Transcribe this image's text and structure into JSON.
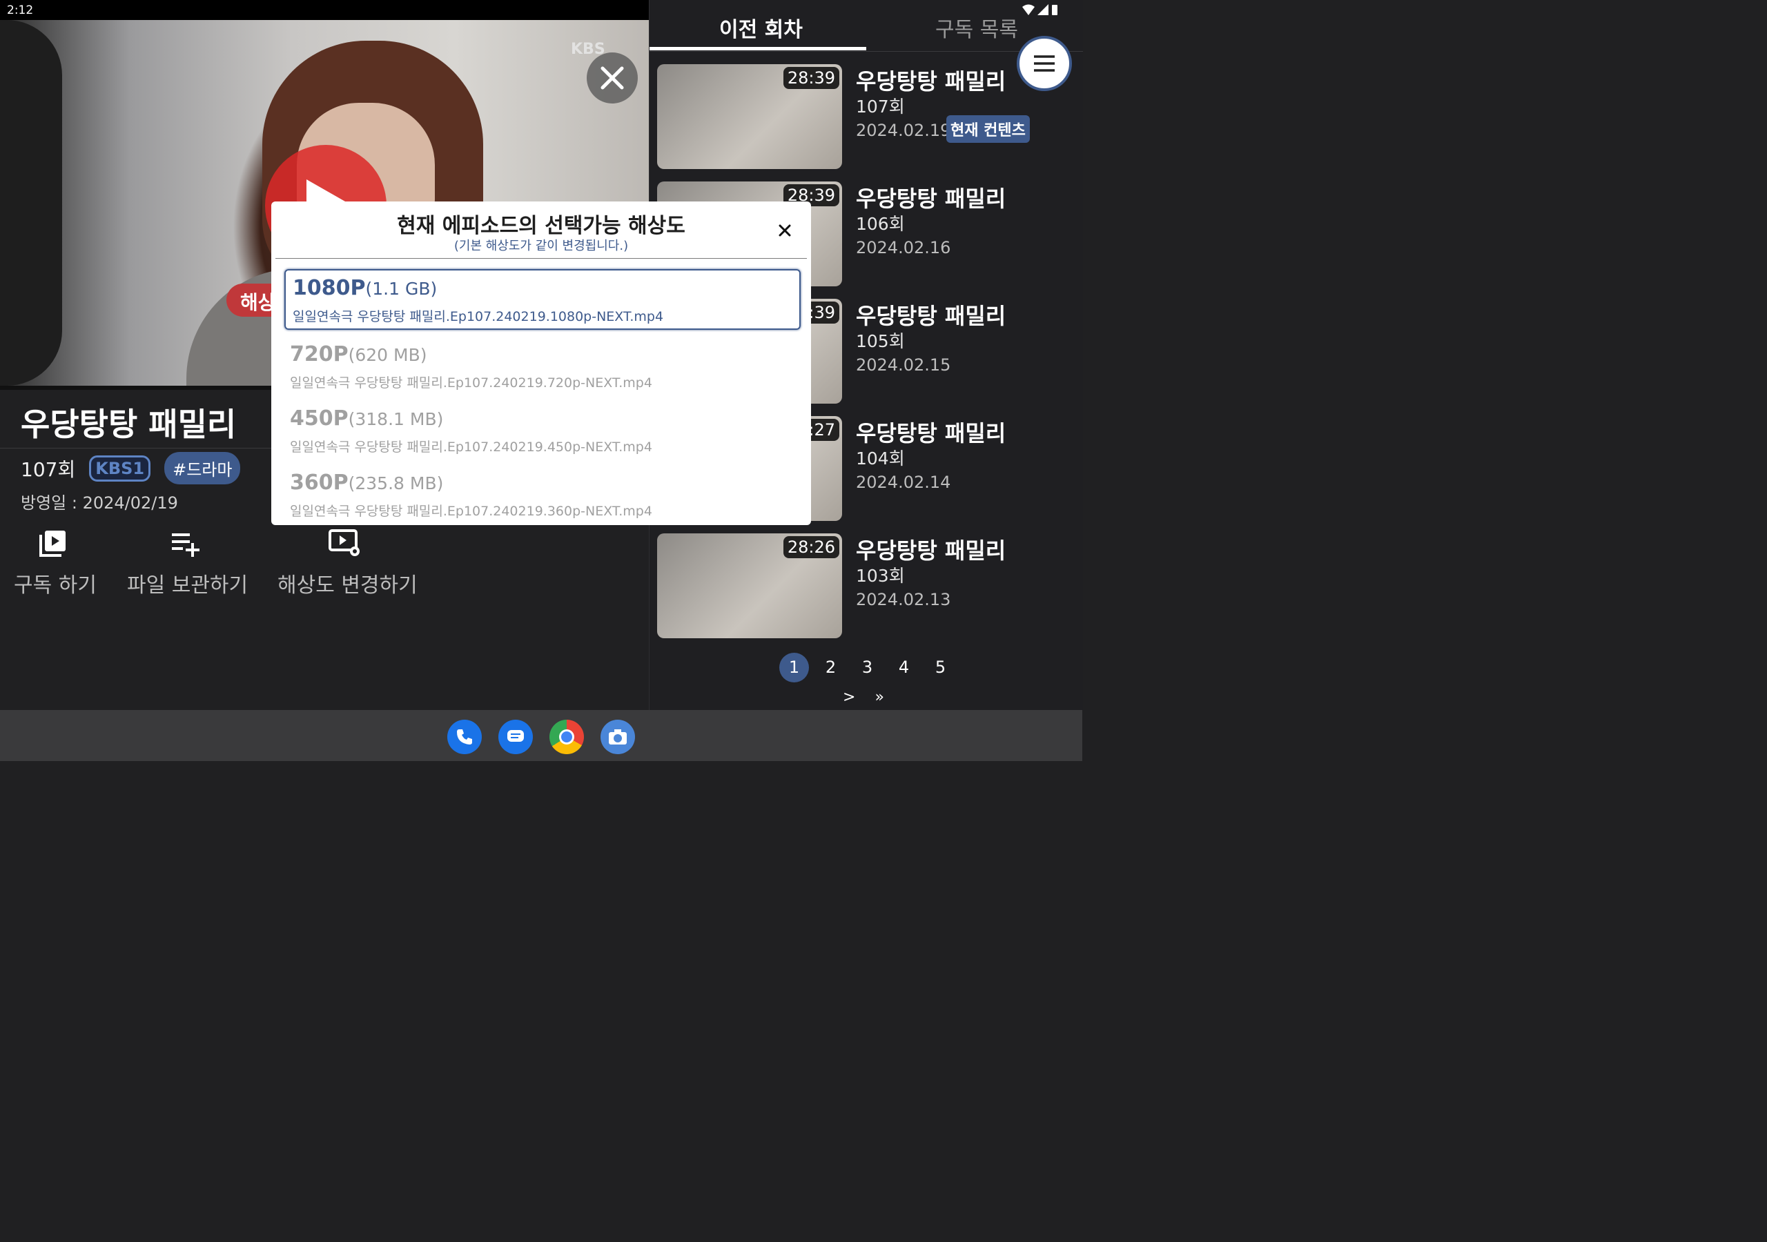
{
  "status": {
    "time": "2:12"
  },
  "video": {
    "watermark": "KBS",
    "resolution_pill": "해상"
  },
  "show": {
    "title": "우당탕탕 패밀리",
    "episode": "107회",
    "channel": "KBS1",
    "genre": "#드라마",
    "airdate": "방영일 : 2024/02/19"
  },
  "actions": [
    {
      "label": "구독 하기",
      "icon": "subscribe-icon"
    },
    {
      "label": "파일 보관하기",
      "icon": "playlist-add-icon"
    },
    {
      "label": "해상도 변경하기",
      "icon": "video-settings-icon"
    }
  ],
  "tabs": {
    "previous": "이전 회차",
    "subscriptions": "구독 목록"
  },
  "episodes": [
    {
      "title": "우당탕탕 패밀리",
      "num": "107회",
      "date": "2024.02.19",
      "duration": "28:39",
      "badge": "현재 컨텐츠"
    },
    {
      "title": "우당탕탕 패밀리",
      "num": "106회",
      "date": "2024.02.16",
      "duration": "28:39"
    },
    {
      "title": "우당탕탕 패밀리",
      "num": "105회",
      "date": "2024.02.15",
      "duration": ":39"
    },
    {
      "title": "우당탕탕 패밀리",
      "num": "104회",
      "date": "2024.02.14",
      "duration": ":27"
    },
    {
      "title": "우당탕탕 패밀리",
      "num": "103회",
      "date": "2024.02.13",
      "duration": "28:26"
    }
  ],
  "pagination": {
    "pages": [
      "1",
      "2",
      "3",
      "4",
      "5"
    ],
    "current": "1",
    "next": ">",
    "last": "»"
  },
  "modal": {
    "title": "현재 에피소드의 선택가능 해상도",
    "subtitle": "(기본 해상도가 같이 변경됩니다.)",
    "options": [
      {
        "res": "1080P",
        "size": "(1.1 GB)",
        "file": "일일연속극 우당탕탕 패밀리.Ep107.240219.1080p-NEXT.mp4",
        "selected": true
      },
      {
        "res": "720P",
        "size": "(620 MB)",
        "file": "일일연속극 우당탕탕 패밀리.Ep107.240219.720p-NEXT.mp4"
      },
      {
        "res": "450P",
        "size": "(318.1 MB)",
        "file": "일일연속극 우당탕탕 패밀리.Ep107.240219.450p-NEXT.mp4"
      },
      {
        "res": "360P",
        "size": "(235.8 MB)",
        "file": "일일연속극 우당탕탕 패밀리.Ep107.240219.360p-NEXT.mp4"
      }
    ]
  },
  "dock": [
    "phone-icon",
    "messages-icon",
    "chrome-icon",
    "camera-icon"
  ],
  "colors": {
    "accent": "#3e5a8c",
    "play": "#dc2828",
    "pill": "#c0383a"
  }
}
